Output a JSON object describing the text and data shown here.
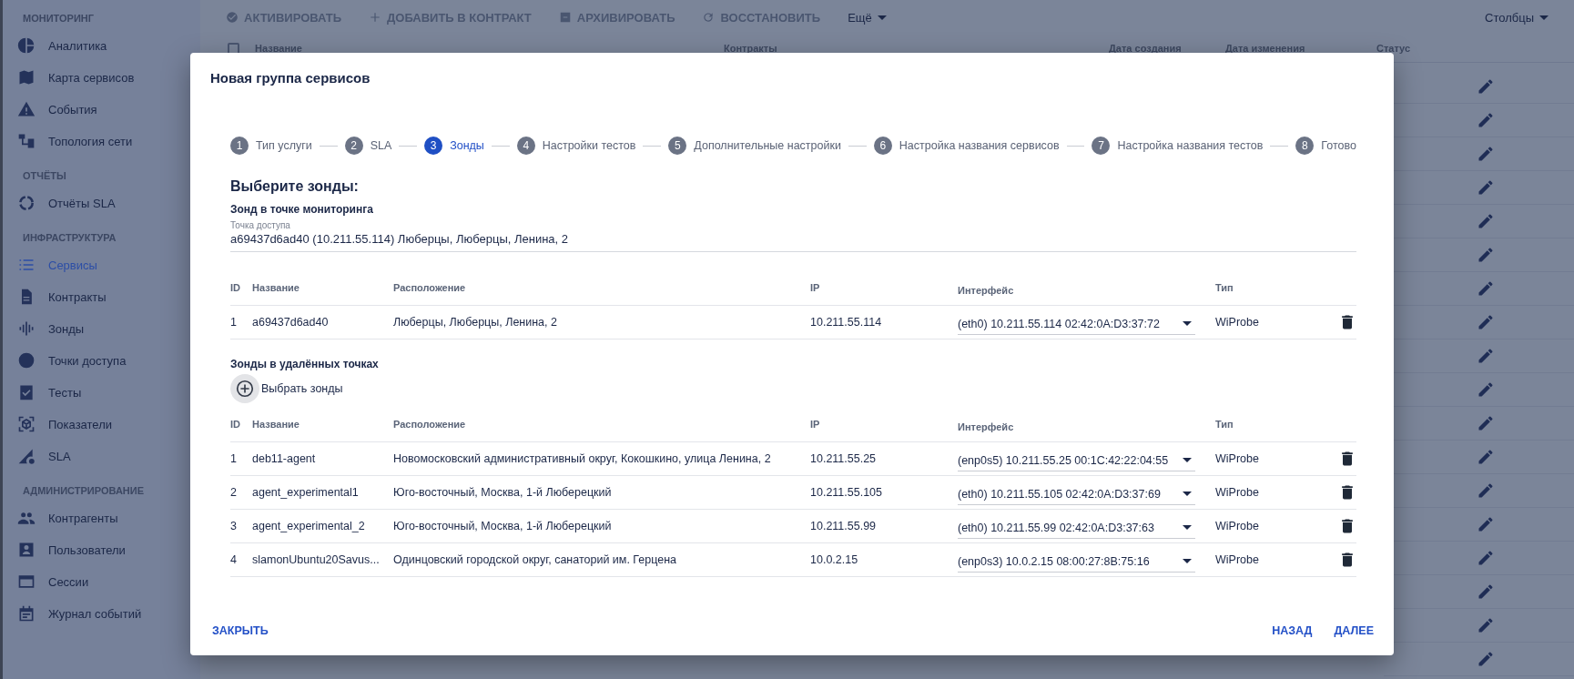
{
  "sidebar": {
    "sections": [
      {
        "title": "МОНИТОРИНГ",
        "items": [
          {
            "label": "Аналитика",
            "selected": false
          },
          {
            "label": "Карта сервисов",
            "selected": false
          },
          {
            "label": "События",
            "selected": false
          },
          {
            "label": "Топология сети",
            "selected": false
          }
        ]
      },
      {
        "title": "ОТЧЁТЫ",
        "items": [
          {
            "label": "Отчёты SLA",
            "selected": false
          }
        ]
      },
      {
        "title": "ИНФРАСТРУКТУРА",
        "items": [
          {
            "label": "Сервисы",
            "selected": true
          },
          {
            "label": "Контракты",
            "selected": false
          },
          {
            "label": "Зонды",
            "selected": false
          },
          {
            "label": "Точки доступа",
            "selected": false
          },
          {
            "label": "Тесты",
            "selected": false
          },
          {
            "label": "Показатели",
            "selected": false
          },
          {
            "label": "SLA",
            "selected": false
          }
        ]
      },
      {
        "title": "АДМИНИСТРИРОВАНИЕ",
        "items": [
          {
            "label": "Контрагенты",
            "selected": false
          },
          {
            "label": "Пользователи",
            "selected": false
          },
          {
            "label": "Сессии",
            "selected": false
          },
          {
            "label": "Журнал событий",
            "selected": false
          }
        ]
      }
    ]
  },
  "toolbar": {
    "actions": [
      {
        "label": "АКТИВИРОВАТЬ",
        "disabled": true
      },
      {
        "label": "ДОБАВИТЬ В КОНТРАКТ",
        "disabled": true
      },
      {
        "label": "АРХИВИРОВАТЬ",
        "disabled": true
      },
      {
        "label": "ВОССТАНОВИТЬ",
        "disabled": true
      },
      {
        "label": "Ещё",
        "disabled": false
      }
    ],
    "columns_button": "Столбцы"
  },
  "table": {
    "select_all": {
      "checked": false
    },
    "columns": [
      "Название",
      "Контракты",
      "Дата создания",
      "Дата изменения",
      "Статус"
    ]
  },
  "dialog": {
    "title": "Новая группа сервисов",
    "steps": [
      {
        "number": "1",
        "label": "Тип услуги",
        "selected": false
      },
      {
        "number": "2",
        "label": "SLA",
        "selected": false
      },
      {
        "number": "3",
        "label": "Зонды",
        "selected": true
      },
      {
        "number": "4",
        "label": "Настройки тестов",
        "selected": false
      },
      {
        "number": "5",
        "label": "Дополнительные настройки",
        "selected": false
      },
      {
        "number": "6",
        "label": "Настройка названия сервисов",
        "selected": false
      },
      {
        "number": "7",
        "label": "Настройка названия тестов",
        "selected": false
      },
      {
        "number": "8",
        "label": "Готово",
        "selected": false
      }
    ],
    "heading": "Выберите зонды:",
    "local_probe": {
      "title": "Зонд в точке мониторинга",
      "field_label": "Точка доступа",
      "field_value": "a69437d6ad40 (10.211.55.114) Люберцы, Люберцы, Ленина, 2",
      "columns": [
        "ID",
        "Название",
        "Расположение",
        "IP",
        "Интерфейс",
        "Тип"
      ],
      "rows": [
        {
          "id": "1",
          "name": "a69437d6ad40",
          "location": "Люберцы, Люберцы, Ленина, 2",
          "ip": "10.211.55.114",
          "interface": "(eth0) 10.211.55.114 02:42:0A:D3:37:72",
          "type": "WiProbe"
        }
      ]
    },
    "remote_probes": {
      "title": "Зонды в удалённых точках",
      "add_button": "Выбрать зонды",
      "columns": [
        "ID",
        "Название",
        "Расположение",
        "IP",
        "Интерфейс",
        "Тип"
      ],
      "rows": [
        {
          "id": "1",
          "name": "deb11-agent",
          "location": "Новомосковский административный округ, Кокошкино, улица Ленина, 2",
          "ip": "10.211.55.25",
          "interface": "(enp0s5) 10.211.55.25 00:1C:42:22:04:55",
          "type": "WiProbe"
        },
        {
          "id": "2",
          "name": "agent_experimental1",
          "location": "Юго-восточный, Москва, 1-й Люберецкий",
          "ip": "10.211.55.105",
          "interface": "(eth0) 10.211.55.105 02:42:0A:D3:37:69",
          "type": "WiProbe"
        },
        {
          "id": "3",
          "name": "agent_experimental_2",
          "location": "Юго-восточный, Москва, 1-й Люберецкий",
          "ip": "10.211.55.99",
          "interface": "(eth0) 10.211.55.99 02:42:0A:D3:37:63",
          "type": "WiProbe"
        },
        {
          "id": "4",
          "name": "slamonUbuntu20Savus...",
          "location": "Одинцовский городской округ, санаторий им. Герцена",
          "ip": "10.0.2.15",
          "interface": "(enp0s3) 10.0.2.15 08:00:27:8B:75:16",
          "type": "WiProbe"
        }
      ]
    },
    "footer": {
      "close": "ЗАКРЫТЬ",
      "back": "НАЗАД",
      "next": "ДАЛЕЕ"
    }
  }
}
